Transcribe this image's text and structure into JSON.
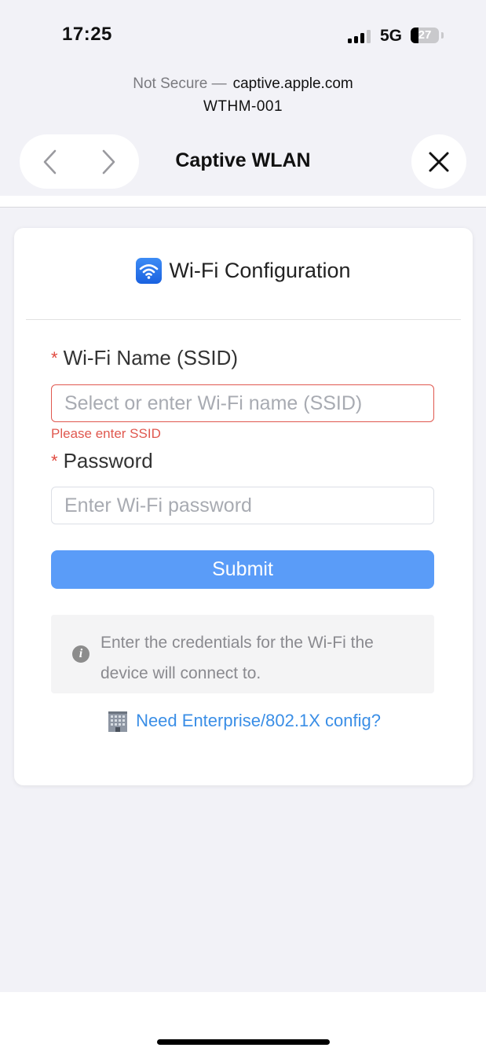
{
  "status_bar": {
    "time": "17:25",
    "network": "5G",
    "battery_level": "27",
    "battery_fraction": 0.27
  },
  "browser": {
    "not_secure_label": "Not Secure —",
    "host": "captive.apple.com",
    "ssid": "WTHM-001",
    "title": "Captive WLAN",
    "icons": [
      "chevron-left-icon",
      "chevron-right-icon",
      "close-icon"
    ]
  },
  "form": {
    "header_icon": "wifi-icon",
    "header_title": "Wi-Fi Configuration",
    "required_marker": "*",
    "ssid_label": "Wi-Fi Name (SSID)",
    "ssid_placeholder": "Select or enter Wi-Fi name (SSID)",
    "ssid_value": "",
    "ssid_error": "Please enter SSID",
    "password_label": "Password",
    "password_placeholder": "Enter Wi-Fi password",
    "password_value": "",
    "submit_label": "Submit",
    "info_icon": "info-icon",
    "info_text": "Enter the credentials for the Wi-Fi the device will connect to.",
    "enterprise_icon": "building-icon",
    "enterprise_link": "Need Enterprise/802.1X config?"
  },
  "colors": {
    "accent": "#5a9cf8",
    "link": "#3a8ee6",
    "error": "#e0584f",
    "background": "#f2f2f7"
  }
}
